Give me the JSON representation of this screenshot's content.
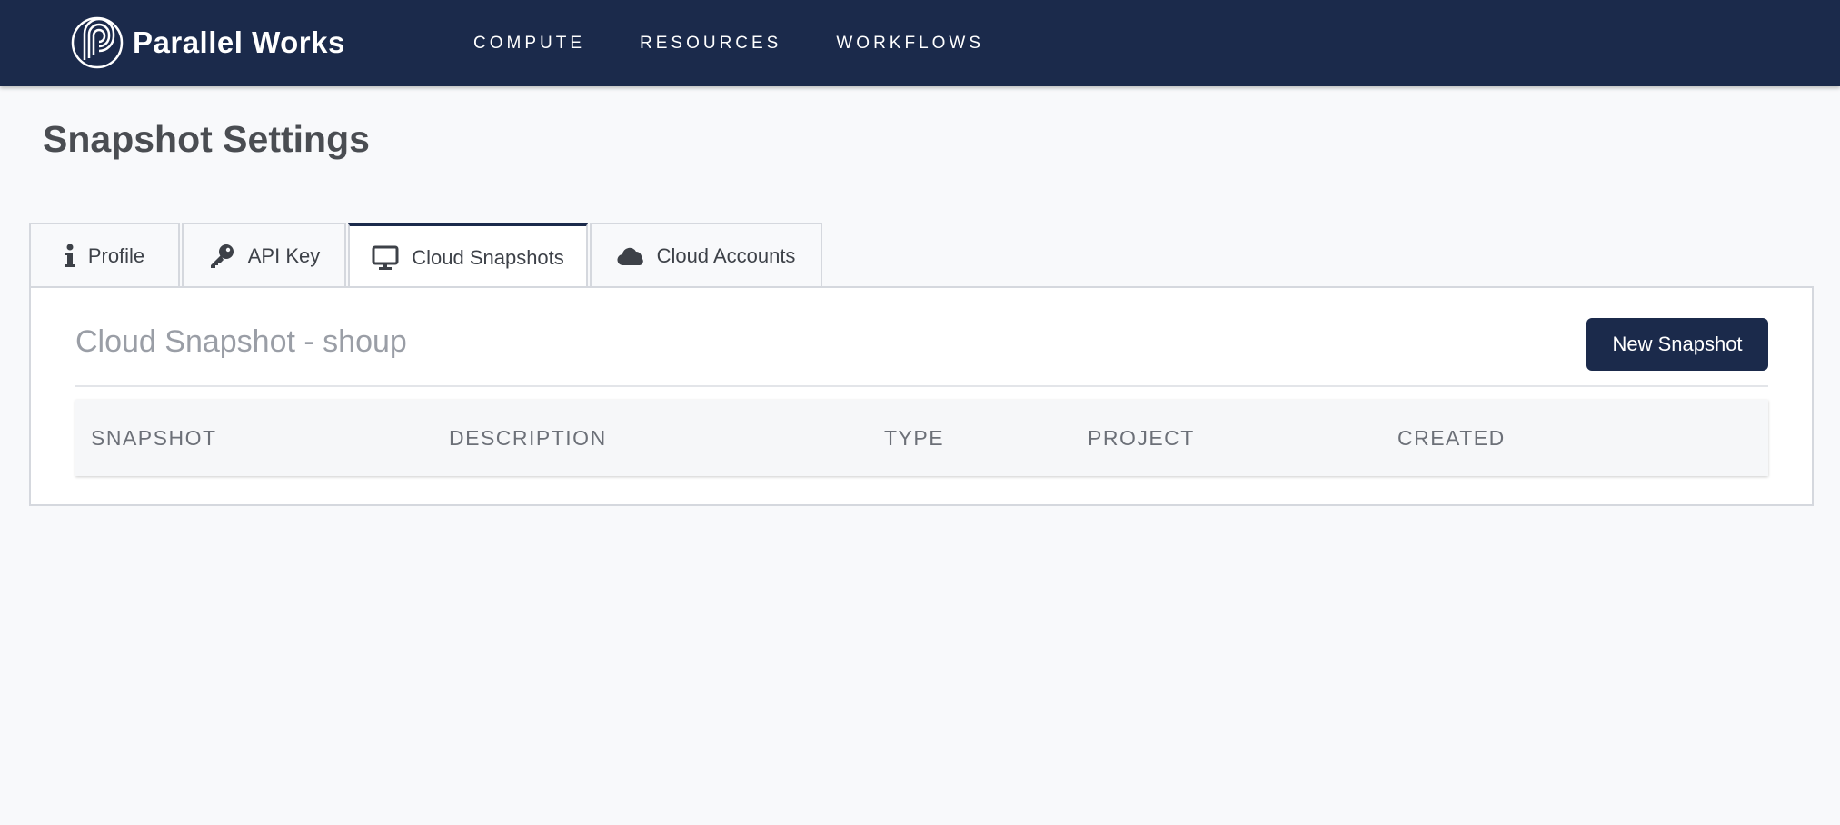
{
  "brand": {
    "name": "Parallel Works",
    "logo_icon": "parallel-works-logo-icon",
    "nav_bg": "#1b2a4b"
  },
  "nav": {
    "items": [
      "COMPUTE",
      "RESOURCES",
      "WORKFLOWS"
    ]
  },
  "page": {
    "title": "Snapshot Settings"
  },
  "tabs": [
    {
      "label": "Profile",
      "icon": "info-icon",
      "active": false
    },
    {
      "label": "API Key",
      "icon": "key-icon",
      "active": false
    },
    {
      "label": "Cloud Snapshots",
      "icon": "monitor-icon",
      "active": true
    },
    {
      "label": "Cloud Accounts",
      "icon": "cloud-icon",
      "active": false
    }
  ],
  "panel": {
    "title": "Cloud Snapshot - shoup",
    "new_button": "New Snapshot"
  },
  "table": {
    "columns": [
      "SNAPSHOT",
      "DESCRIPTION",
      "TYPE",
      "PROJECT",
      "CREATED"
    ],
    "rows": []
  }
}
